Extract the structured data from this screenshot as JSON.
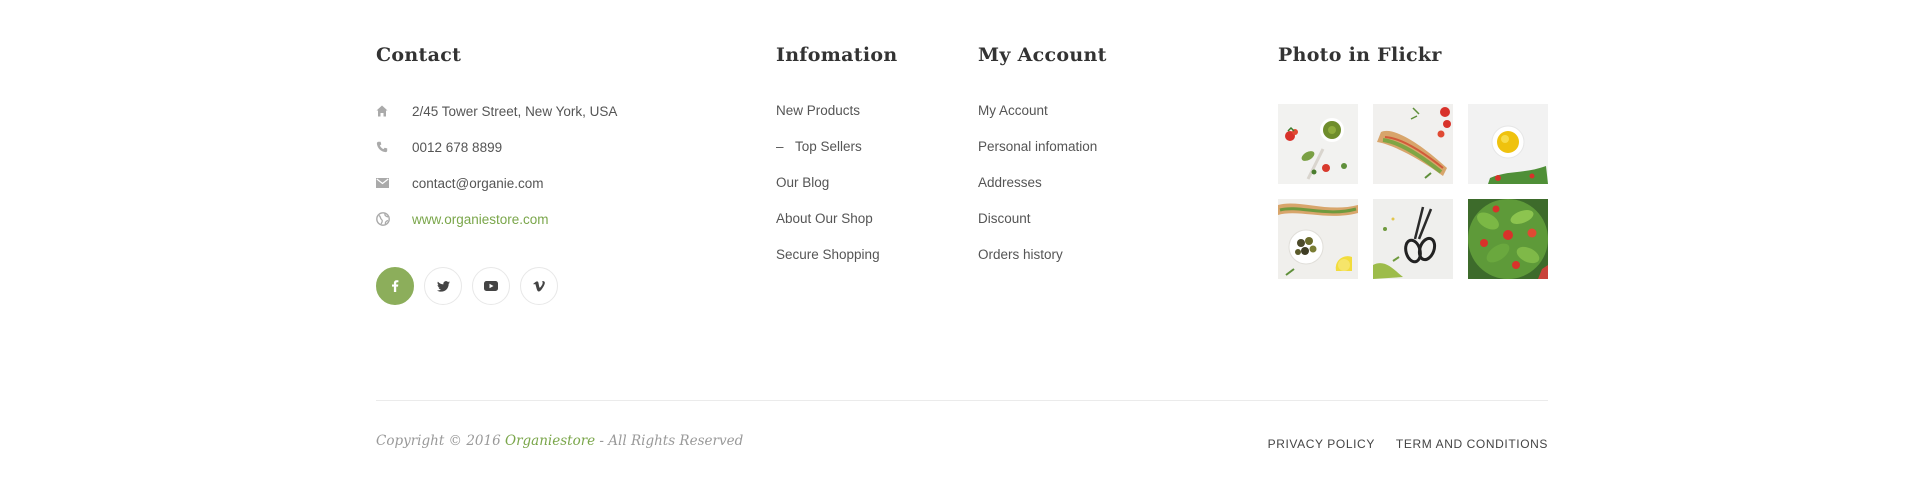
{
  "contact": {
    "title": "Contact",
    "items": [
      {
        "icon": "home-icon",
        "text": "2/45 Tower Street, New York, USA"
      },
      {
        "icon": "phone-icon",
        "text": "0012 678 8899"
      },
      {
        "icon": "mail-icon",
        "text": "contact@organie.com"
      },
      {
        "icon": "globe-icon",
        "text": "www.organiestore.com"
      }
    ],
    "socials": [
      "facebook-icon",
      "twitter-icon",
      "youtube-icon",
      "vimeo-icon"
    ],
    "accent": "#8cae5b",
    "link_color": "#7aa64a"
  },
  "info": {
    "title": "Infomation",
    "links": [
      "New Products",
      "Top Sellers",
      "Our Blog",
      "About Our Shop",
      "Secure Shopping"
    ],
    "dash": "–"
  },
  "account": {
    "title": "My Account",
    "links": [
      "My Account",
      "Personal infomation",
      "Addresses",
      "Discount",
      "Orders history"
    ]
  },
  "flickr": {
    "title": "Photo in Flickr"
  },
  "footer": {
    "copyright_prefix": "Copyright © 2016 ",
    "brand": "Organiestore",
    "copyright_suffix": " - All Rights Reserved",
    "privacy": "PRIVACY POLICY",
    "terms": "TERM AND CONDITIONS"
  }
}
